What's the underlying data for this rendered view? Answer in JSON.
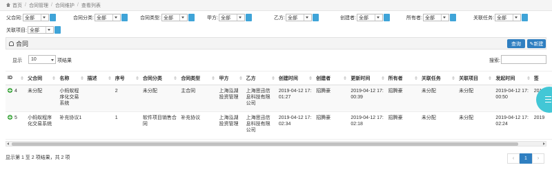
{
  "breadcrumb": [
    "首页",
    "合同管理",
    "合同维护",
    "查看列表"
  ],
  "filters": {
    "row1": [
      {
        "label": "父合同:",
        "value": "全部"
      },
      {
        "label": "合同分类:",
        "value": "全部"
      },
      {
        "label": "合同类型:",
        "value": "全部"
      },
      {
        "label": "甲方:",
        "value": "全部"
      },
      {
        "label": "乙方:",
        "value": "全部"
      },
      {
        "label": "创建者:",
        "value": "全部"
      },
      {
        "label": "所有者:",
        "value": "全部"
      },
      {
        "label": "关联任务:",
        "value": "全部"
      }
    ],
    "row2": [
      {
        "label": "关联项目:",
        "value": "全部"
      }
    ]
  },
  "panel": {
    "title": "合同",
    "query_label": "查询",
    "new_label": "新建"
  },
  "toolbar": {
    "show_label": "显示",
    "page_length": "10",
    "records_label": "项结果",
    "search_label": "搜索:"
  },
  "table": {
    "headers": [
      "ID",
      "父合同",
      "名称",
      "描述",
      "序号",
      "合同分类",
      "合同类型",
      "甲方",
      "乙方",
      "创建时间",
      "创建者",
      "更新时间",
      "所有者",
      "关联任务",
      "关联项目",
      "发起时间",
      "签"
    ],
    "rows": [
      [
        "4",
        "未分配",
        "小蚂蚁程序化交易系统",
        "",
        "2",
        "未分配",
        "主合同",
        "上海泓湖投资管理",
        "上海思迅信息科技有限公司",
        "2019-04-12 17:01:27",
        "招腾豪",
        "2019-04-12 17:00:39",
        "招腾豪",
        "未分配",
        "未分配",
        "2019-04-12 17:00:50",
        "2019"
      ],
      [
        "5",
        "小蚂蚁程序化交易系统",
        "补充协议1",
        "",
        "1",
        "软件项目销售合同",
        "补充协议",
        "上海泓湖投资管理",
        "上海思迅信息科技有限公司",
        "2019-04-12 17:02:34",
        "招腾豪",
        "2019-04-12 17:02:18",
        "招腾豪",
        "未分配",
        "未分配",
        "2019-04-12 17:02:24",
        "2019"
      ]
    ]
  },
  "footer": {
    "info": "显示第 1 至 2 项结果，共 2 项",
    "prev": "‹",
    "page": "1",
    "next": "›"
  },
  "colors": {
    "accent": "#2f7fc1",
    "fab": "#42c7d6",
    "add_icon": "#3aa53a"
  }
}
